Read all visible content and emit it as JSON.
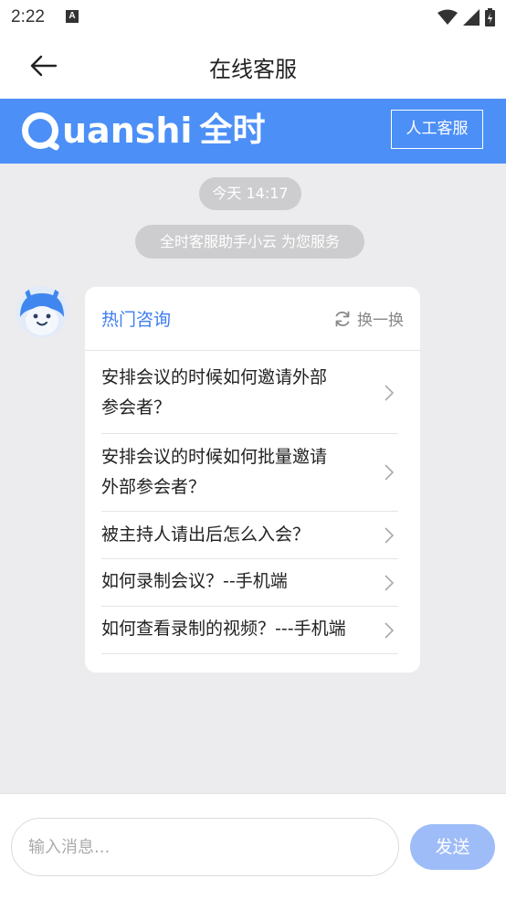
{
  "status_bar": {
    "time": "2:22",
    "notification_glyph": "A"
  },
  "nav": {
    "title": "在线客服",
    "back_icon": "arrow-left-icon"
  },
  "banner": {
    "brand_latin": "uanshi",
    "brand_cn": "全时",
    "human_service_label": "人工客服",
    "accent_color": "#4c8ff7"
  },
  "chat": {
    "time_label": "今天 14:17",
    "notice": "全时客服助手小云 为您服务",
    "card": {
      "title": "热门咨询",
      "refresh_label": "换一换",
      "questions": [
        {
          "line1": "安排会议的时候如何邀请外部",
          "line2": "参会者？"
        },
        {
          "line1": "安排会议的时候如何批量邀请",
          "line2": "外部参会者？"
        },
        {
          "line1": "被主持人请出后怎么入会？"
        },
        {
          "line1": "如何录制会议？--手机端"
        },
        {
          "line1": "如何查看录制的视频？---手机端"
        }
      ]
    }
  },
  "input_bar": {
    "placeholder": "输入消息...",
    "send_label": "发送"
  }
}
